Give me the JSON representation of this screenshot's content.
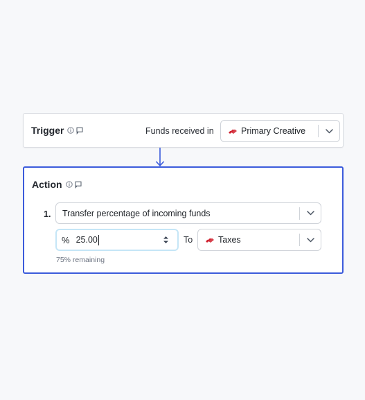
{
  "trigger": {
    "title": "Trigger",
    "info_icon": "info-circle-icon",
    "comment_icon": "comment-icon",
    "label": "Funds received in",
    "account": {
      "name": "Primary Creative",
      "flag_icon": "bank-flag-icon"
    }
  },
  "connector_icon": "arrow-down-icon",
  "action": {
    "title": "Action",
    "info_icon": "info-circle-icon",
    "comment_icon": "comment-icon",
    "step_number": "1.",
    "rule_type": "Transfer percentage of incoming funds",
    "percent_symbol": "%",
    "percent_value": "25.00",
    "to_label": "To",
    "destination": {
      "name": "Taxes",
      "flag_icon": "bank-flag-icon"
    },
    "remaining_text": "75% remaining"
  },
  "colors": {
    "accent": "#3b5bdb",
    "focus_ring": "#c5e6f7",
    "flag_red": "#d0202e"
  }
}
